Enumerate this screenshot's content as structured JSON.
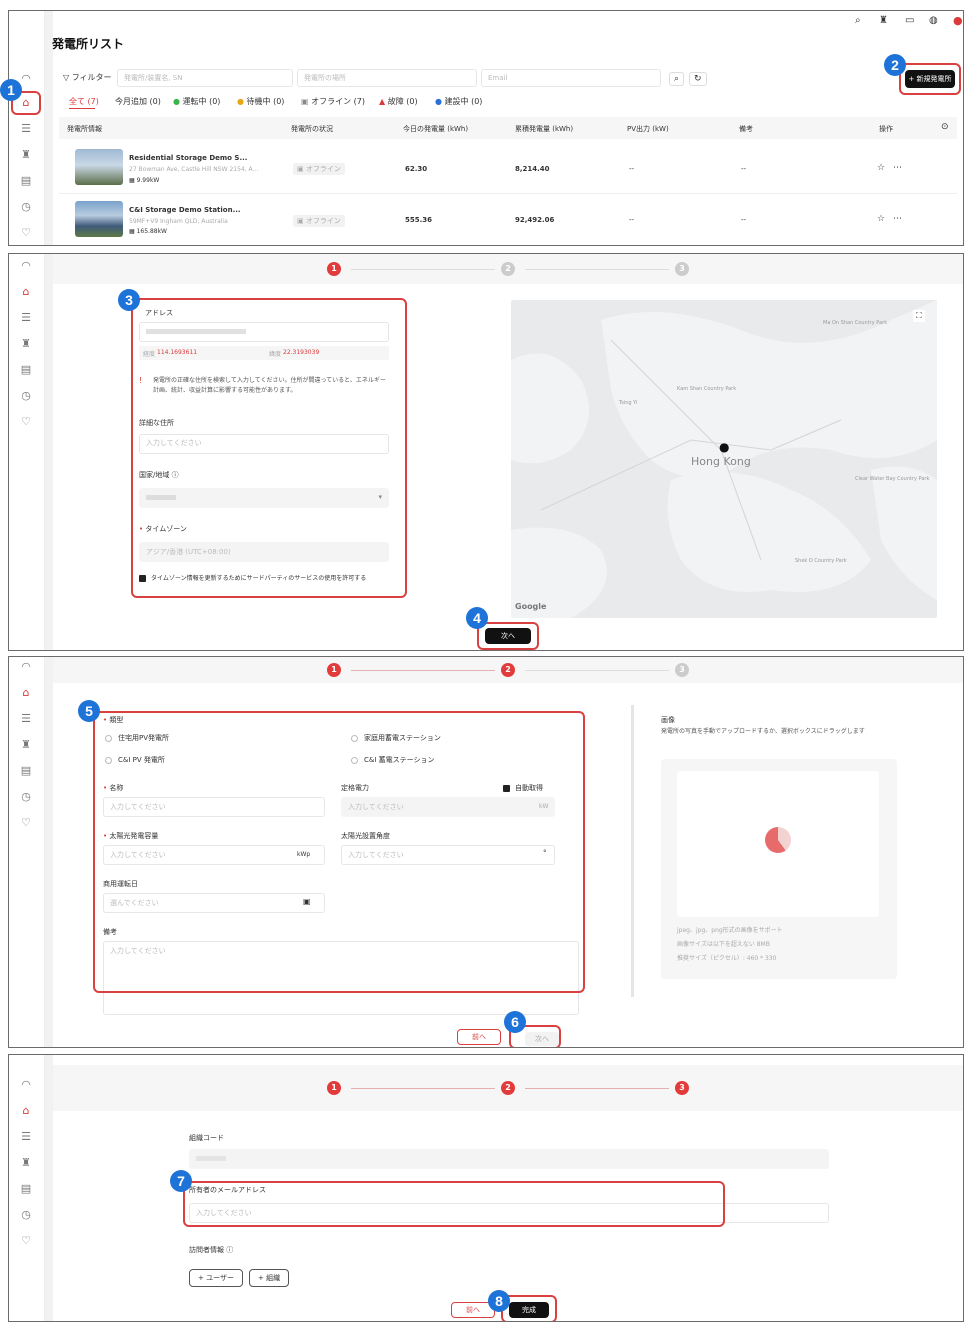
{
  "badges": [
    "1",
    "2",
    "3",
    "4",
    "5",
    "6",
    "7",
    "8"
  ],
  "panel1": {
    "title": "発電所リスト",
    "filter_label": "フィルター",
    "filter_placeholders": [
      "発電所/装置名, SN",
      "発電所の場所",
      "Email"
    ],
    "new_button": "+ 新規発電所",
    "tabs": [
      "全て (7)",
      "今月追加 (0)",
      "運転中 (0)",
      "待機中 (0)",
      "オフライン (7)",
      "故障 (0)",
      "建設中 (0)"
    ],
    "columns": [
      "発電所情報",
      "発電所の状況",
      "今日の発電量 (kWh)",
      "累積発電量 (kWh)",
      "PV出力 (kW)",
      "備考",
      "操作"
    ],
    "rows": [
      {
        "name": "Residential Storage Demo S...",
        "address": "27 Bowman Ave, Castle Hill NSW 2154, A...",
        "capacity": "9.99kW",
        "status": "オフライン",
        "today": "62.30",
        "total": "8,214.40",
        "pv": "--",
        "note": "--"
      },
      {
        "name": "C&I Storage Demo Station...",
        "address": "59MF+V9 Ingham QLD, Australia",
        "capacity": "165.88kW",
        "status": "オフライン",
        "today": "555.36",
        "total": "92,492.06",
        "pv": "--",
        "note": "--"
      }
    ]
  },
  "panel2": {
    "steps": [
      "1",
      "2",
      "3"
    ],
    "address_label": "アドレス",
    "lng_label": "経度",
    "lng": "114.1693611",
    "lat_label": "緯度",
    "lat": "22.3193039",
    "warning": "発電所の正確な住所を検索して入力してください。住所が間違っていると、エネルギー計画、統計、収益計算に影響する可能性があります。",
    "detail_label": "詳細な住所",
    "detail_placeholder": "入力してください",
    "country_label": "国家/地域",
    "timezone_label": "タイムゾーン",
    "timezone_value": "アジア/香港 (UTC+08:00)",
    "tz_checkbox": "タイムゾーン情報を更新するためにサードパーティのサービスの使用を許可する",
    "next_button": "次へ",
    "map_labels": [
      "Hong Kong",
      "Kam Shan Country Park",
      "Ma On Shan Country Park",
      "Shek O Country Park",
      "Clear Water Bay Country Park",
      "Tsing Yi"
    ],
    "google": "Google"
  },
  "panel3": {
    "type_label": "類型",
    "types": [
      "住宅用PV発電所",
      "家庭用蓄電ステーション",
      "C&I PV 発電所",
      "C&I 蓄電ステーション"
    ],
    "name_label": "名称",
    "name_placeholder": "入力してください",
    "rated_label": "定格電力",
    "auto_label": "自動取得",
    "rated_unit": "kW",
    "pv_cap_label": "太陽光発電容量",
    "pv_unit": "kWp",
    "angle_label": "太陽光設置角度",
    "angle_unit": "°",
    "date_label": "商用運転日",
    "date_placeholder": "選んでください",
    "note_label": "備考",
    "image_label": "画像",
    "image_desc": "発電所の写真を手動でアップロードするか、選択ボックスにドラッグします",
    "image_hint1": "jpeg、jpg、png形式の画像をサポート",
    "image_hint2": "画像サイズは以下を超えない 8MB",
    "image_hint3": "推奨サイズ（ピクセル）: 460 * 330",
    "prev_button": "前へ",
    "next_button": "次へ"
  },
  "panel4": {
    "org_label": "組織コード",
    "owner_label": "所有者のメールアドレス",
    "owner_placeholder": "入力してください",
    "visitor_label": "訪問者情報",
    "add_user": "+ ユーザー",
    "add_org": "+ 組織",
    "prev_button": "前へ",
    "finish_button": "完成"
  }
}
